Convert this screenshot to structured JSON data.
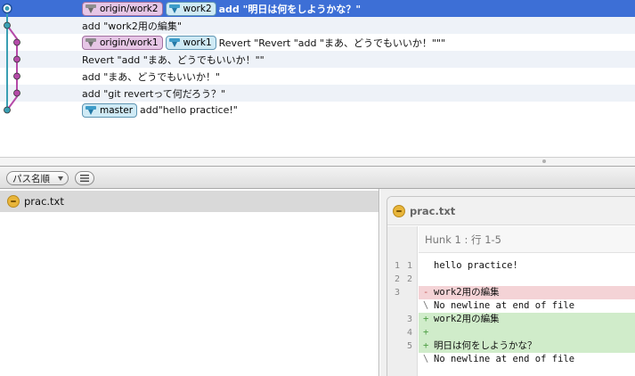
{
  "history": {
    "commits": [
      {
        "refs": [
          {
            "label": "origin/work2",
            "kind": "remote"
          },
          {
            "label": "work2",
            "kind": "local",
            "head": true
          }
        ],
        "message": "add \"明日は何をしようかな？\"",
        "selected": true
      },
      {
        "refs": [],
        "message": "add \"work2用の編集\"",
        "selected": false
      },
      {
        "refs": [
          {
            "label": "origin/work1",
            "kind": "remote"
          },
          {
            "label": "work1",
            "kind": "local"
          }
        ],
        "message": "Revert \"Revert \"add \"まあ、どうでもいいか！\"\"\"",
        "selected": false
      },
      {
        "refs": [],
        "message": "Revert \"add \"まあ、どうでもいいか！\"\"",
        "selected": false
      },
      {
        "refs": [],
        "message": "add \"まあ、どうでもいいか！\"",
        "selected": false
      },
      {
        "refs": [],
        "message": "add \"git revertって何だろう？\"",
        "selected": false
      },
      {
        "refs": [
          {
            "label": "master",
            "kind": "local"
          }
        ],
        "message": "add\"hello practice!\"",
        "selected": false
      }
    ],
    "colors": {
      "lane_main": "#3a9fb3",
      "lane_work1": "#b54aa8",
      "selected_row": "#3d6fd6"
    }
  },
  "toolbar": {
    "sort_label": "パス名順",
    "list_icon": "list-icon"
  },
  "files": [
    {
      "name": "prac.txt",
      "status_icon": "modified-icon"
    }
  ],
  "diff": {
    "file_name": "prac.txt",
    "hunk_header": "Hunk 1 : 行 1-5",
    "lines": [
      {
        "type": "ctx",
        "old": "1",
        "new": "1",
        "mark": " ",
        "text": "hello practice!"
      },
      {
        "type": "ctx",
        "old": "2",
        "new": "2",
        "mark": " ",
        "text": ""
      },
      {
        "type": "del",
        "old": "3",
        "new": "",
        "mark": "-",
        "text": "work2用の編集"
      },
      {
        "type": "ctx",
        "old": "",
        "new": "",
        "mark": "\\",
        "text": "No newline at end of file"
      },
      {
        "type": "add",
        "old": "",
        "new": "3",
        "mark": "+",
        "text": "work2用の編集"
      },
      {
        "type": "add",
        "old": "",
        "new": "4",
        "mark": "+",
        "text": ""
      },
      {
        "type": "add",
        "old": "",
        "new": "5",
        "mark": "+",
        "text": "明日は何をしようかな？"
      },
      {
        "type": "ctx",
        "old": "",
        "new": "",
        "mark": "\\",
        "text": "No newline at end of file"
      }
    ]
  }
}
